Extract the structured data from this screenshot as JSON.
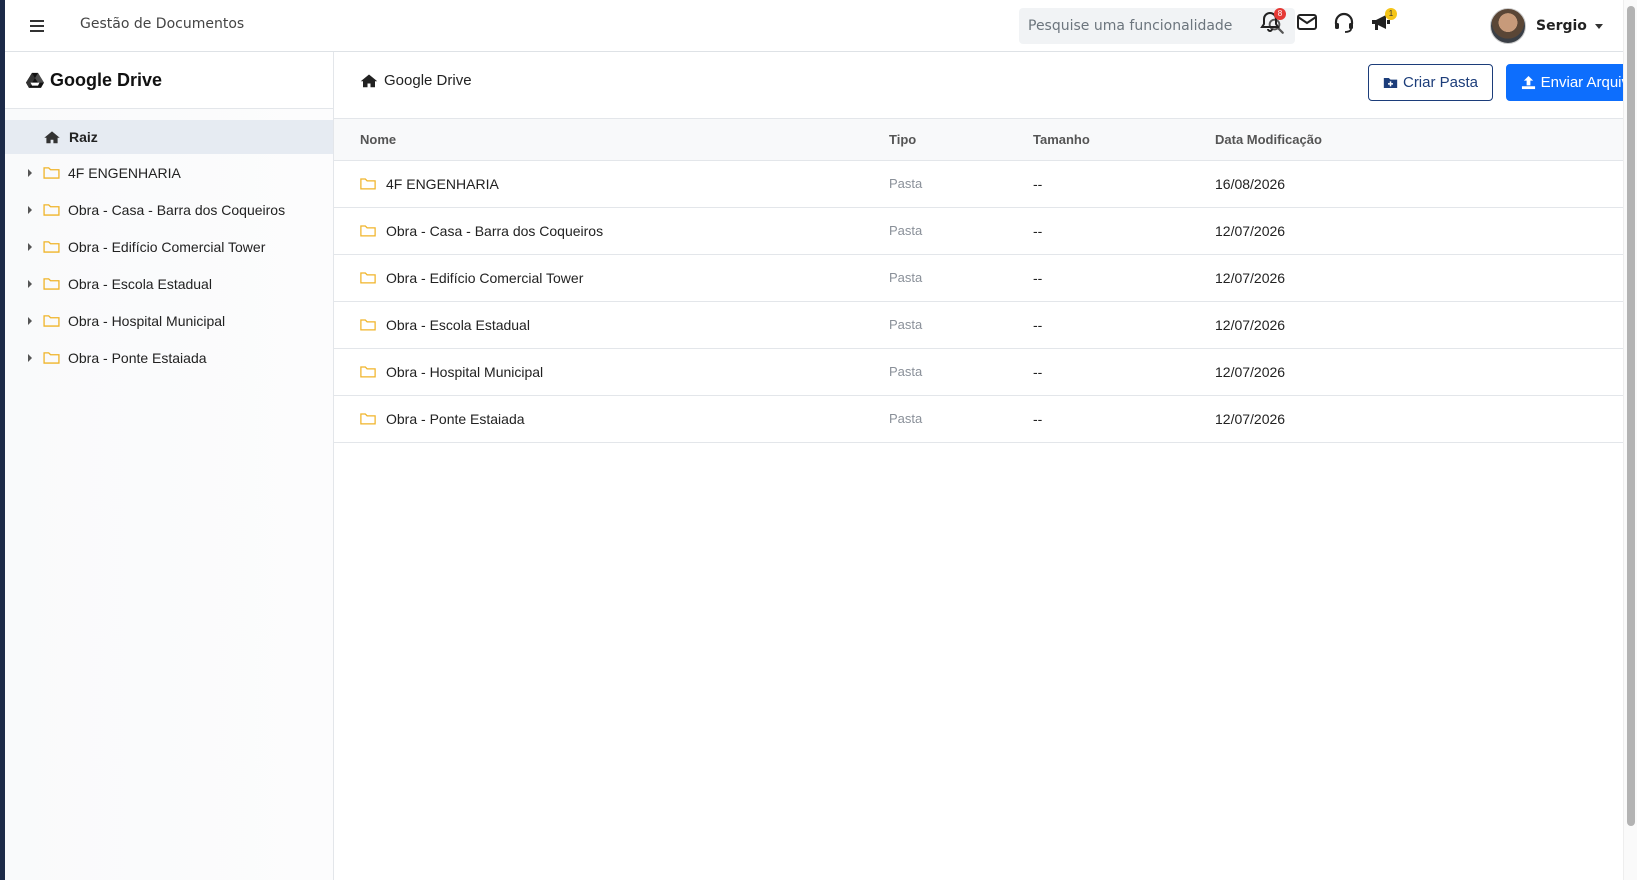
{
  "header": {
    "app_title": "Gestão de Documentos",
    "search_placeholder": "Pesquise uma funcionalidade",
    "notifications_badge": "8",
    "announcements_badge": "1",
    "user_name": "Sergio"
  },
  "sidebar": {
    "title": "Google Drive",
    "root_label": "Raiz",
    "items": [
      {
        "label": "4F ENGENHARIA"
      },
      {
        "label": "Obra - Casa - Barra dos Coqueiros"
      },
      {
        "label": "Obra - Edifício Comercial Tower"
      },
      {
        "label": "Obra - Escola Estadual"
      },
      {
        "label": "Obra - Hospital Municipal"
      },
      {
        "label": "Obra - Ponte Estaiada"
      }
    ]
  },
  "main": {
    "breadcrumb": "Google Drive",
    "create_folder_label": "Criar Pasta",
    "upload_label": "Enviar Arquivo",
    "columns": [
      "Nome",
      "Tipo",
      "Tamanho",
      "Data Modificação"
    ],
    "rows": [
      {
        "name": "4F ENGENHARIA",
        "type": "Pasta",
        "size": "--",
        "date": "16/08/2026"
      },
      {
        "name": "Obra - Casa - Barra dos Coqueiros",
        "type": "Pasta",
        "size": "--",
        "date": "12/07/2026"
      },
      {
        "name": "Obra - Edifício Comercial Tower",
        "type": "Pasta",
        "size": "--",
        "date": "12/07/2026"
      },
      {
        "name": "Obra - Escola Estadual",
        "type": "Pasta",
        "size": "--",
        "date": "12/07/2026"
      },
      {
        "name": "Obra - Hospital Municipal",
        "type": "Pasta",
        "size": "--",
        "date": "12/07/2026"
      },
      {
        "name": "Obra - Ponte Estaiada",
        "type": "Pasta",
        "size": "--",
        "date": "12/07/2026"
      }
    ]
  },
  "colors": {
    "primary": "#0d6efd",
    "outline": "#1c3d7a",
    "folder": "#f0b429",
    "selected_bg": "#e6ebf2"
  }
}
